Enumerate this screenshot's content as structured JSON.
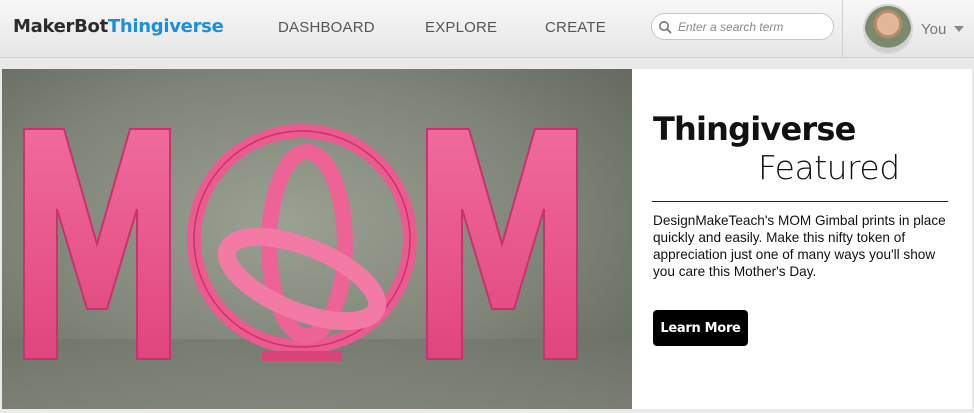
{
  "header": {
    "logo": {
      "maker": "MakerBot",
      "thing": "Thingiverse"
    },
    "nav": [
      {
        "label": "DASHBOARD"
      },
      {
        "label": "EXPLORE"
      },
      {
        "label": "CREATE"
      }
    ],
    "search": {
      "placeholder": "Enter a search term",
      "icon": "search-icon"
    },
    "user": {
      "label": "You",
      "icon": "chevron-down-icon"
    }
  },
  "featured": {
    "title": "Thingiverse",
    "subtitle": "Featured",
    "description": "DesignMakeTeach's MOM Gimbal prints in place quickly and easily. Make this nifty token of appreciation just one of many ways you'll show you care this Mother's Day.",
    "button_label": "Learn More"
  },
  "colors": {
    "brand_blue": "#1a8fe0",
    "print_pink": "#ea4f86",
    "button": "#000000"
  }
}
